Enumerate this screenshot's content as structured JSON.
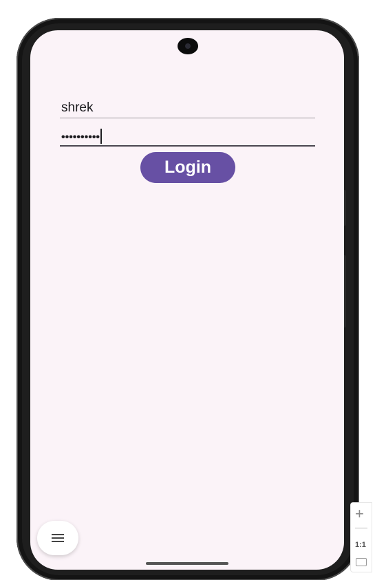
{
  "login_form": {
    "username_value": "shrek",
    "password_value": "••••••••••",
    "login_label": "Login"
  },
  "emulator": {
    "zoom_in_symbol": "+",
    "zoom_ratio_label": "1:1"
  },
  "icons": {
    "fab": "menu-icon",
    "zoom_fit": "fit-screen-icon"
  },
  "colors": {
    "screen_background": "#fbf3f8",
    "accent": "#6750a4",
    "button_text": "#ffffff"
  }
}
